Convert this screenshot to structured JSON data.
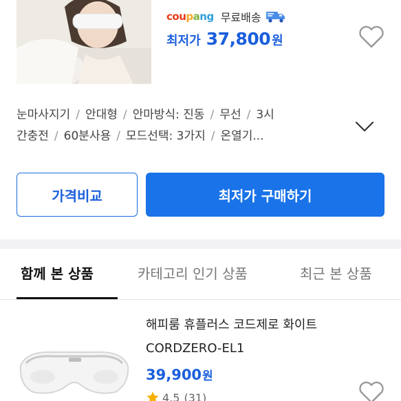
{
  "listing": {
    "seller_logo": [
      "cou",
      "p",
      "a",
      "ng"
    ],
    "free_shipping": "무료배송",
    "price_prefix": "최저가",
    "price": "37,800",
    "price_unit": "원"
  },
  "specs": {
    "line1": [
      "눈마사지기",
      "안대형",
      "안마방식: 진동",
      "무선",
      "3시"
    ],
    "line2": [
      "간충전",
      "60분사용",
      "모드선택: 3가지",
      "온열기..."
    ]
  },
  "buttons": {
    "compare": "가격비교",
    "buy": "최저가 구매하기"
  },
  "tabs": [
    "함께 본 상품",
    "카테고리 인기 상품",
    "최근 본 상품"
  ],
  "related_product": {
    "title": "해피룸 휴플러스 코드제로 화이트 CORDZERO-EL1",
    "price": "39,900",
    "price_unit": "원",
    "rating": "4.5",
    "review_count": "(31)"
  },
  "colors": {
    "accent": "#1a73e8",
    "price": "#1a5fdc"
  },
  "icons": [
    "truck-icon",
    "heart-icon",
    "chevron-down-icon",
    "star-icon"
  ]
}
